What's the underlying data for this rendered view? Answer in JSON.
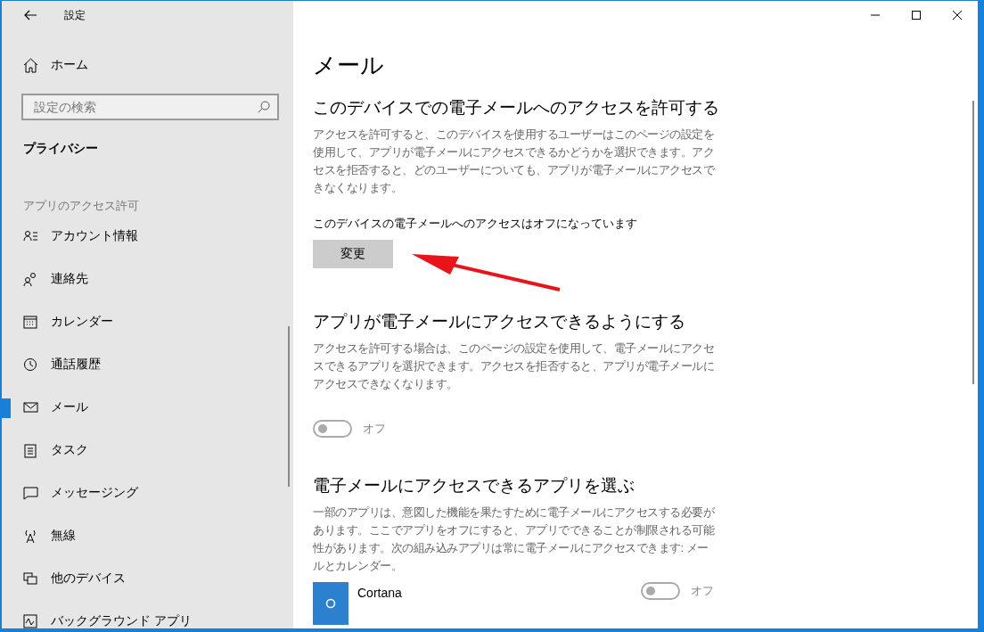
{
  "window": {
    "title": "設定"
  },
  "sidebar": {
    "home": "ホーム",
    "search": {
      "placeholder": "設定の検索"
    },
    "category": "プライバシー",
    "group_label": "アプリのアクセス許可",
    "items": [
      {
        "label": "アカウント情報",
        "selected": false
      },
      {
        "label": "連絡先",
        "selected": false
      },
      {
        "label": "カレンダー",
        "selected": false
      },
      {
        "label": "通話履歴",
        "selected": false
      },
      {
        "label": "メール",
        "selected": true
      },
      {
        "label": "タスク",
        "selected": false
      },
      {
        "label": "メッセージング",
        "selected": false
      },
      {
        "label": "無線",
        "selected": false
      },
      {
        "label": "他のデバイス",
        "selected": false
      },
      {
        "label": "バックグラウンド アプリ",
        "selected": false
      }
    ]
  },
  "main": {
    "title": "メール",
    "device_access": {
      "heading": "このデバイスでの電子メールへのアクセスを許可する",
      "description": "アクセスを許可すると、このデバイスを使用するユーザーはこのページの設定を使用して、アプリが電子メールにアクセスできるかどうかを選択できます。アクセスを拒否すると、どのユーザーについても、アプリが電子メールにアクセスできなくなります。",
      "status": "このデバイスの電子メールへのアクセスはオフになっています",
      "button": "変更"
    },
    "app_access": {
      "heading": "アプリが電子メールにアクセスできるようにする",
      "description": "アクセスを許可する場合は、このページの設定を使用して、電子メールにアクセスできるアプリを選択できます。アクセスを拒否すると、アプリが電子メールにアクセスできなくなります。",
      "toggle": {
        "on": false,
        "disabled": true,
        "label": "オフ"
      }
    },
    "choose_apps": {
      "heading": "電子メールにアクセスできるアプリを選ぶ",
      "description": "一部のアプリは、意図した機能を果たすために電子メールにアクセスする必要があります。ここでアプリをオフにすると、アプリでできることが制限される可能性があります。次の組み込みアプリは常に電子メールにアクセスできます: メールとカレンダー。",
      "apps": [
        {
          "name": "Cortana",
          "on": false,
          "disabled": true,
          "label": "オフ"
        }
      ]
    }
  }
}
